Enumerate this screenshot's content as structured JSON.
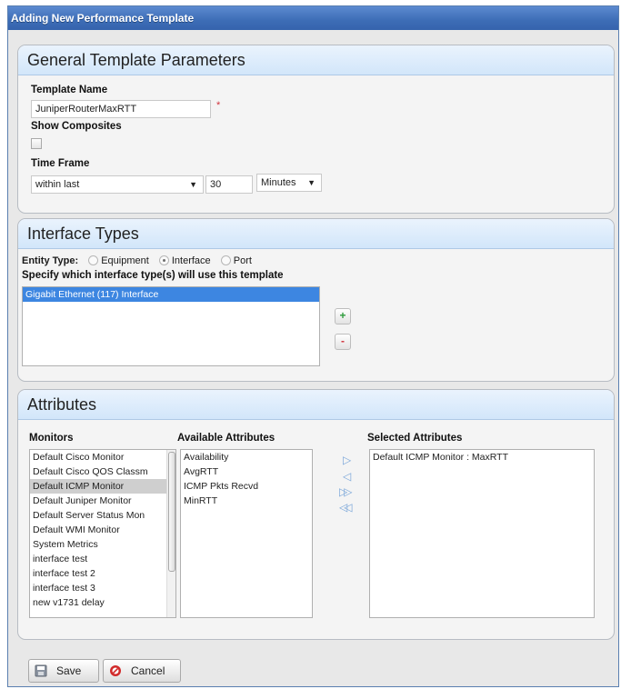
{
  "window": {
    "title": "Adding New Performance Template"
  },
  "general": {
    "header": "General Template Parameters",
    "template_name_label": "Template Name",
    "template_name_value": "JuniperRouterMaxRTT",
    "required_mark": "*",
    "show_composites_label": "Show Composites",
    "show_composites_checked": false,
    "time_frame_label": "Time Frame",
    "time_frame_value": "within last",
    "time_amount": "30",
    "time_unit": "Minutes"
  },
  "interface_types": {
    "header": "Interface Types",
    "entity_type_label": "Entity Type:",
    "options": [
      "Equipment",
      "Interface",
      "Port"
    ],
    "selected_option": "Interface",
    "specify_label": "Specify which interface type(s) will use this template",
    "list": [
      "Gigabit Ethernet (117) Interface"
    ],
    "add_icon": "+",
    "remove_icon": "-"
  },
  "attributes": {
    "header": "Attributes",
    "monitors_label": "Monitors",
    "available_label": "Available Attributes",
    "selected_label": "Selected Attributes",
    "monitors": [
      "Default Cisco Monitor",
      "Default Cisco QOS Classm",
      "Default ICMP Monitor",
      "Default Juniper Monitor",
      "Default Server Status Mon",
      "Default WMI Monitor",
      "System Metrics",
      "interface test",
      "interface test 2",
      "interface test 3",
      "new v1731 delay"
    ],
    "selected_monitor": "Default ICMP Monitor",
    "available": [
      "Availability",
      "AvgRTT",
      "ICMP Pkts Recvd",
      "MinRTT"
    ],
    "selected": [
      "Default ICMP Monitor : MaxRTT"
    ]
  },
  "footer": {
    "save_label": "Save",
    "cancel_label": "Cancel"
  },
  "colors": {
    "accent": "#3d86e1",
    "title_bar": "#3d6db6",
    "cancel_red": "#d12a2a"
  }
}
